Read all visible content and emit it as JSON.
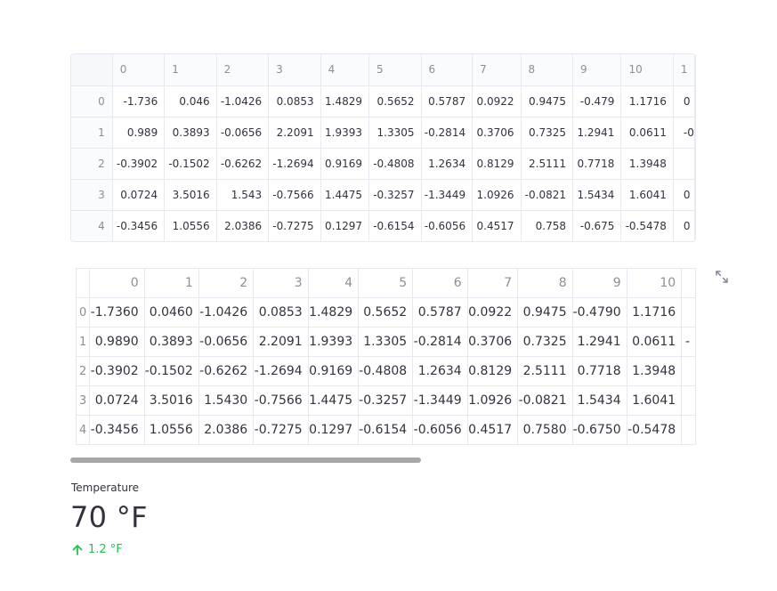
{
  "dataframe": {
    "columns": [
      "0",
      "1",
      "2",
      "3",
      "4",
      "5",
      "6",
      "7",
      "8",
      "9",
      "10",
      "1"
    ],
    "index": [
      "0",
      "1",
      "2",
      "3",
      "4"
    ],
    "rows": [
      [
        "-1.736",
        "0.046",
        "-1.0426",
        "0.0853",
        "1.4829",
        "0.5652",
        "0.5787",
        "0.0922",
        "0.9475",
        "-0.479",
        "1.1716",
        "0"
      ],
      [
        "0.989",
        "0.3893",
        "-0.0656",
        "2.2091",
        "1.9393",
        "1.3305",
        "-0.2814",
        "0.3706",
        "0.7325",
        "1.2941",
        "0.0611",
        "-0"
      ],
      [
        "-0.3902",
        "-0.1502",
        "-0.6262",
        "-1.2694",
        "0.9169",
        "-0.4808",
        "1.2634",
        "0.8129",
        "2.5111",
        "0.7718",
        "1.3948",
        ""
      ],
      [
        "0.0724",
        "3.5016",
        "1.543",
        "-0.7566",
        "1.4475",
        "-0.3257",
        "-1.3449",
        "1.0926",
        "-0.0821",
        "1.5434",
        "1.6041",
        "0"
      ],
      [
        "-0.3456",
        "1.0556",
        "2.0386",
        "-0.7275",
        "0.1297",
        "-0.6154",
        "-0.6056",
        "0.4517",
        "0.758",
        "-0.675",
        "-0.5478",
        "0"
      ]
    ]
  },
  "table": {
    "columns": [
      "0",
      "1",
      "2",
      "3",
      "4",
      "5",
      "6",
      "7",
      "8",
      "9",
      "10",
      ""
    ],
    "index": [
      "0",
      "1",
      "2",
      "3",
      "4"
    ],
    "rows": [
      [
        "-1.7360",
        "0.0460",
        "-1.0426",
        "0.0853",
        "1.4829",
        "0.5652",
        "0.5787",
        "0.0922",
        "0.9475",
        "-0.4790",
        "1.1716",
        ""
      ],
      [
        "0.9890",
        "0.3893",
        "-0.0656",
        "2.2091",
        "1.9393",
        "1.3305",
        "-0.2814",
        "0.3706",
        "0.7325",
        "1.2941",
        "0.0611",
        "-"
      ],
      [
        "-0.3902",
        "-0.1502",
        "-0.6262",
        "-1.2694",
        "0.9169",
        "-0.4808",
        "1.2634",
        "0.8129",
        "2.5111",
        "0.7718",
        "1.3948",
        ""
      ],
      [
        "0.0724",
        "3.5016",
        "1.5430",
        "-0.7566",
        "1.4475",
        "-0.3257",
        "-1.3449",
        "1.0926",
        "-0.0821",
        "1.5434",
        "1.6041",
        ""
      ],
      [
        "-0.3456",
        "1.0556",
        "2.0386",
        "-0.7275",
        "0.1297",
        "-0.6154",
        "-0.6056",
        "0.4517",
        "0.7580",
        "-0.6750",
        "-0.5478",
        ""
      ]
    ]
  },
  "metric": {
    "label": "Temperature",
    "value": "70 °F",
    "delta": "1.2 °F",
    "delta_direction": "up",
    "delta_color": "#21c354"
  },
  "icons": {
    "expand": "expand-icon",
    "delta_arrow": "arrow-up-icon"
  }
}
